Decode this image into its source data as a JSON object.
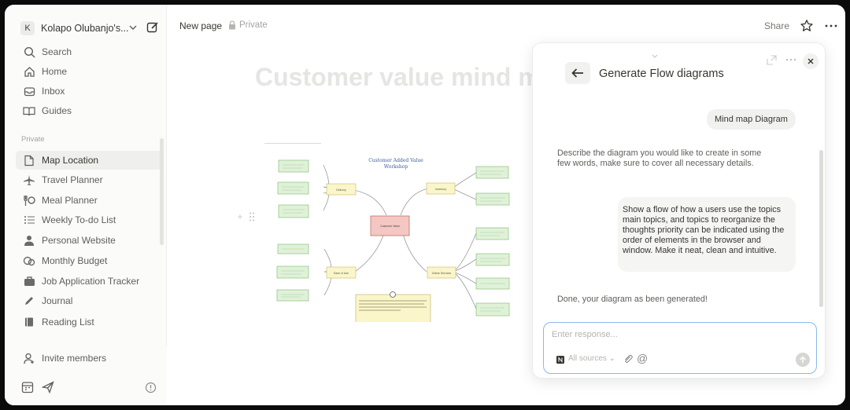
{
  "workspace": {
    "initial": "K",
    "name": "Kolapo Olubanjo's..."
  },
  "nav": {
    "search": "Search",
    "home": "Home",
    "inbox": "Inbox",
    "guides": "Guides"
  },
  "sidebar": {
    "section_label": "Private",
    "items": [
      {
        "label": "Map Location",
        "icon": "page-icon",
        "active": true
      },
      {
        "label": "Travel Planner",
        "icon": "airplane-icon"
      },
      {
        "label": "Meal Planner",
        "icon": "utensils-icon"
      },
      {
        "label": "Weekly To-do List",
        "icon": "list-icon"
      },
      {
        "label": "Personal Website",
        "icon": "person-icon"
      },
      {
        "label": "Monthly Budget",
        "icon": "coins-icon"
      },
      {
        "label": "Job Application Tracker",
        "icon": "briefcase-icon"
      },
      {
        "label": "Journal",
        "icon": "pencil-icon"
      },
      {
        "label": "Reading List",
        "icon": "book-icon"
      }
    ],
    "invite": "Invite members"
  },
  "topbar": {
    "breadcrumb": "New page",
    "privacy": "Private",
    "share": "Share"
  },
  "page": {
    "title": "Customer value mind m"
  },
  "mindmap": {
    "title_line1": "Customer Added Value",
    "title_line2": "Workshop",
    "center": "Customer Value",
    "hubs": [
      "Delivery",
      "Inventory",
      "Ease of Use",
      "Online Services"
    ],
    "note": "The Mind Mapping diagram shows the use of central nodes, hierarchy and branches to organize thoughts clearly and visually using the ordered elements in the visual window."
  },
  "panel": {
    "title": "Generate Flow diagrams",
    "chip": "Mind map Diagram",
    "assistant_prompt": "Describe the diagram you would like to create in some few words, make sure to cover all necessary details.",
    "user_message": "Show a flow of how a users use the topics main topics, and topics to reorganize the thoughts priority can be indicated using the order of elements in the browser and window. Make it neat, clean and intuitive.",
    "done_message": "Done, your diagram as been generated!",
    "input_placeholder": "Enter response...",
    "sources_label": "All sources"
  }
}
